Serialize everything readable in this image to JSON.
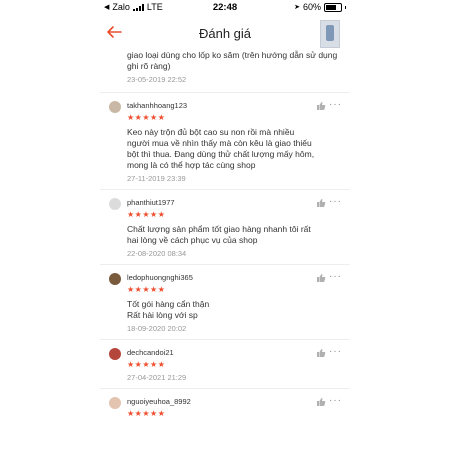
{
  "status_bar": {
    "carrier": "Zalo",
    "network": "LTE",
    "time": "22:48",
    "battery": "60%"
  },
  "header": {
    "title": "Đánh giá"
  },
  "first_review": {
    "text": "giao loại dùng cho lốp ko săm (trên hướng dẫn sử dụng ghi rõ ràng)",
    "date": "23-05-2019 22:52"
  },
  "reviews": [
    {
      "username": "takhanhhoang123",
      "stars": "★★★★★",
      "text": "Keo này trộn đủ bột cao su non rồi mà nhiều\nngười mua về nhìn thấy mà còn kêu là giao thiếu\nbột thì thua. Đang dùng thử chất lượng mấy hôm,\nmong là có thể hợp tác cùng shop",
      "date": "27-11-2019 23:39"
    },
    {
      "username": "phanthiut1977",
      "stars": "★★★★★",
      "text": "Chất lượng sản phẩm tốt giao hàng nhanh tôi rất\nhai lòng về cách phục vụ của shop",
      "date": "22-08-2020 08:34"
    },
    {
      "username": "ledophuongnghi365",
      "stars": "★★★★★",
      "text": "Tốt gói hàng cẩn thận\nRất hài lòng với sp",
      "date": "18-09-2020 20:02"
    },
    {
      "username": "dechcandoi21",
      "stars": "★★★★★",
      "text": "",
      "date": "27-04-2021 21:29"
    },
    {
      "username": "nguoiyeuhoa_8992",
      "stars": "★★★★★",
      "text": "",
      "date": ""
    }
  ]
}
